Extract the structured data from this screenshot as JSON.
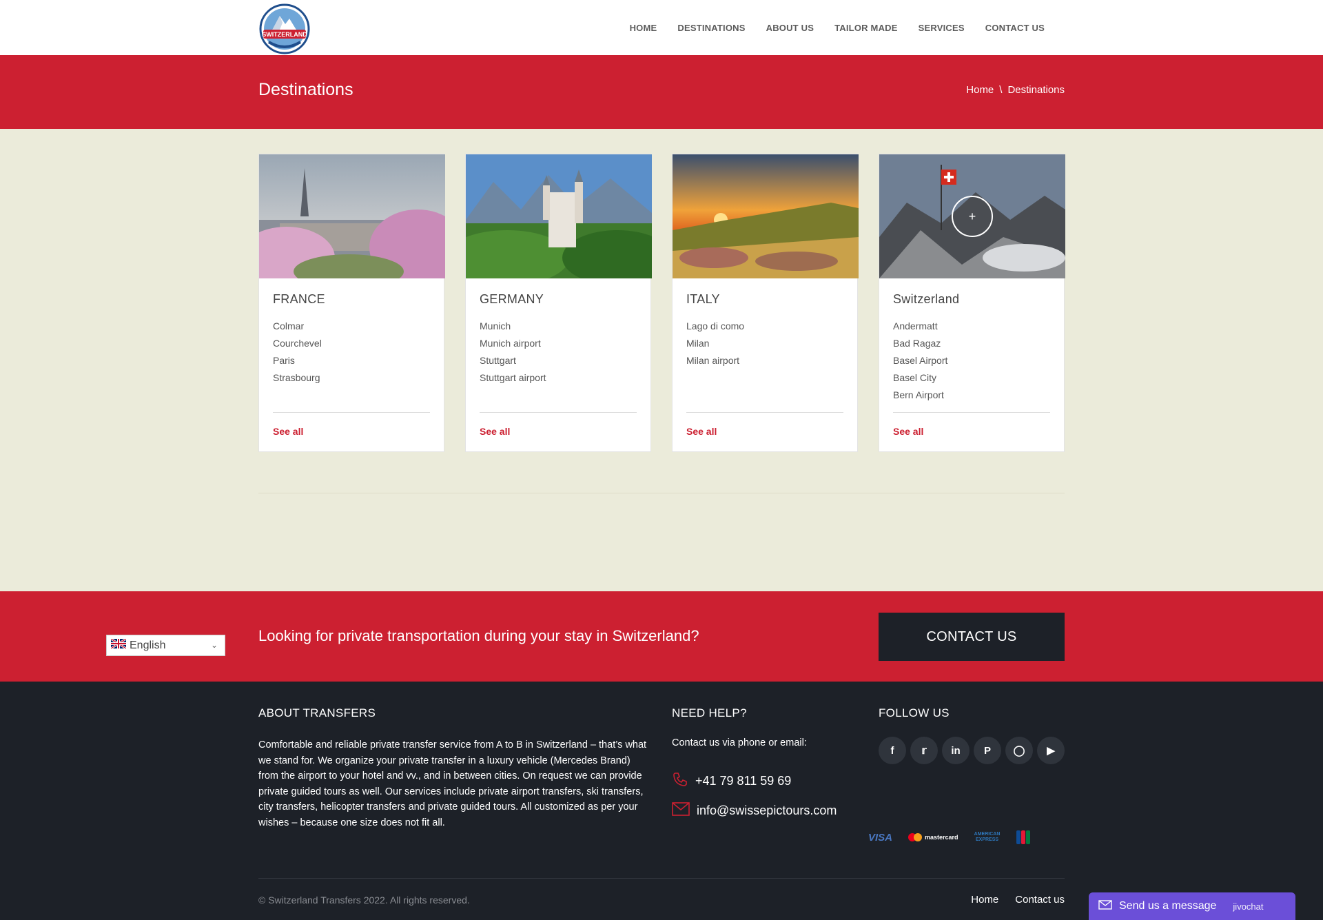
{
  "header": {
    "logo_text": "SWITZERLAND",
    "nav": [
      "HOME",
      "DESTINATIONS",
      "ABOUT US",
      "TAILOR MADE",
      "SERVICES",
      "CONTACT US"
    ]
  },
  "title_band": {
    "title": "Destinations",
    "breadcrumb": {
      "home": "Home",
      "separator": "\\",
      "current": "Destinations"
    }
  },
  "cards": [
    {
      "title": "FRANCE",
      "items": [
        "Colmar",
        "Courchevel",
        "Paris",
        "Strasbourg"
      ],
      "see_all": "See all",
      "image": "paris-eiffel-tower"
    },
    {
      "title": "GERMANY",
      "items": [
        "Munich",
        "Munich airport",
        "Stuttgart",
        "Stuttgart airport"
      ],
      "see_all": "See all",
      "image": "neuschwanstein-castle"
    },
    {
      "title": "ITALY",
      "items": [
        "Lago di como",
        "Milan",
        "Milan airport"
      ],
      "see_all": "See all",
      "image": "tuscany-sunset"
    },
    {
      "title": "Switzerland",
      "items": [
        "Andermatt",
        "Bad Ragaz",
        "Basel Airport",
        "Basel City",
        "Bern Airport"
      ],
      "see_all": "See all",
      "image": "swiss-flag-mountains",
      "hover_icon": "+"
    }
  ],
  "cta": {
    "text": "Looking for private transportation during your stay in Switzerland?",
    "button": "CONTACT US",
    "language": "English"
  },
  "footer": {
    "about_title": "ABOUT TRANSFERS",
    "about_text": "Comfortable and reliable private transfer service from A to B in Switzerland – that’s what we stand for. We organize your private transfer in a luxury vehicle (Mercedes Brand) from the airport to your hotel and vv., and in between cities. On request we can provide private guided tours as well. Our services include private airport transfers, ski transfers, city transfers, helicopter transfers and private guided tours. All customized as per your wishes – because one size does not fit all.",
    "help_title": "NEED HELP?",
    "help_sub": "Contact us via phone or email:",
    "phone": "+41 79 811 59 69",
    "email": "info@swissepictours.com",
    "follow_title": "FOLLOW US",
    "social": [
      "facebook-icon",
      "twitter-icon",
      "linkedin-icon",
      "pinterest-icon",
      "instagram-icon",
      "youtube-icon"
    ],
    "payments": [
      "VISA",
      "mastercard",
      "AMERICAN EXPRESS",
      "JCB"
    ],
    "copyright": "© Switzerland Transfers 2022. All rights reserved.",
    "links": [
      "Home",
      "Contact us"
    ]
  },
  "chat": {
    "label": "Send us a message",
    "brand": "jivochat"
  },
  "colors": {
    "accent": "#cc2031",
    "dark": "#1d2128",
    "page_bg": "#ebebda"
  }
}
